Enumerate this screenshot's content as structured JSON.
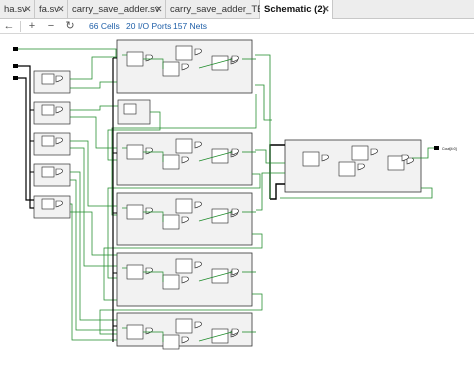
{
  "tabs": [
    {
      "label": "ha.sv"
    },
    {
      "label": "fa.sv"
    },
    {
      "label": "carry_save_adder.sv"
    },
    {
      "label": "carry_save_adder_TB.sv"
    },
    {
      "label": "Schematic (2)"
    }
  ],
  "toolbar": {
    "back_label": "←",
    "zoom_in_label": "+",
    "zoom_out_label": "−",
    "refresh_label": "↻",
    "cells": "66 Cells",
    "ports": "20 I/O Ports",
    "nets": "157 Nets"
  },
  "schematic": {
    "wire_color": "#1e8b2a",
    "bus_color": "#000000",
    "block_border": "#333333",
    "block_fill": "#f2f2f2",
    "cell_fill": "#ffffff",
    "output_port_label": "Cout[4:0]"
  }
}
